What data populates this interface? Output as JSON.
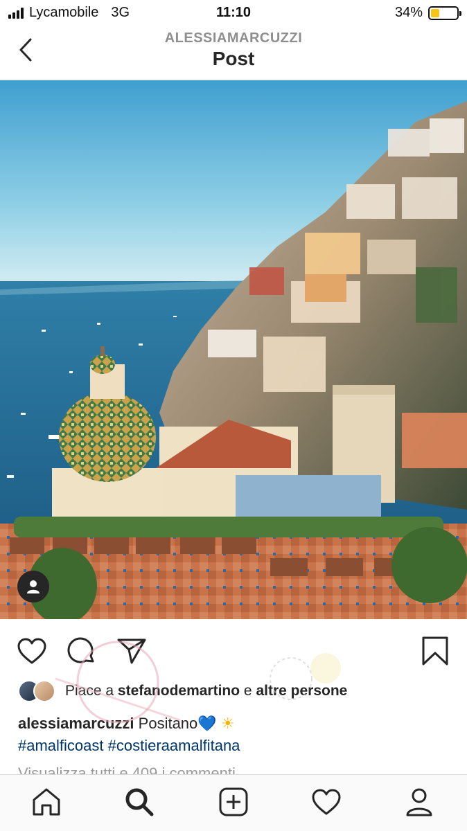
{
  "status_bar": {
    "carrier": "Lycamobile",
    "network": "3G",
    "time": "11:10",
    "battery_percent": "34%",
    "battery_level": 0.34
  },
  "header": {
    "username": "ALESSIAMARCUZZI",
    "title": "Post"
  },
  "post": {
    "likes": {
      "prefix": "Piace a ",
      "user": "stefanodemartino",
      "middle": " e ",
      "others": "altre persone"
    },
    "caption": {
      "author": "alessiamarcuzzi",
      "text": " Positano",
      "emoji_heart": "💙",
      "emoji_sun": "☀"
    },
    "hashtags": [
      "#amalficoast",
      "#costieraamalfitana"
    ],
    "view_comments": "Visualizza tutti e 409 i commenti"
  },
  "colors": {
    "link": "#003569",
    "muted": "#8e8e8e",
    "border": "#dbdbdb"
  },
  "icons": {
    "back": "chevron-left-icon",
    "like": "heart-outline-icon",
    "comment": "comment-bubble-icon",
    "share": "paper-plane-icon",
    "save": "bookmark-icon",
    "user_tag": "person-icon",
    "tabs": [
      "home-icon",
      "search-icon",
      "add-post-icon",
      "activity-heart-icon",
      "profile-icon"
    ]
  }
}
